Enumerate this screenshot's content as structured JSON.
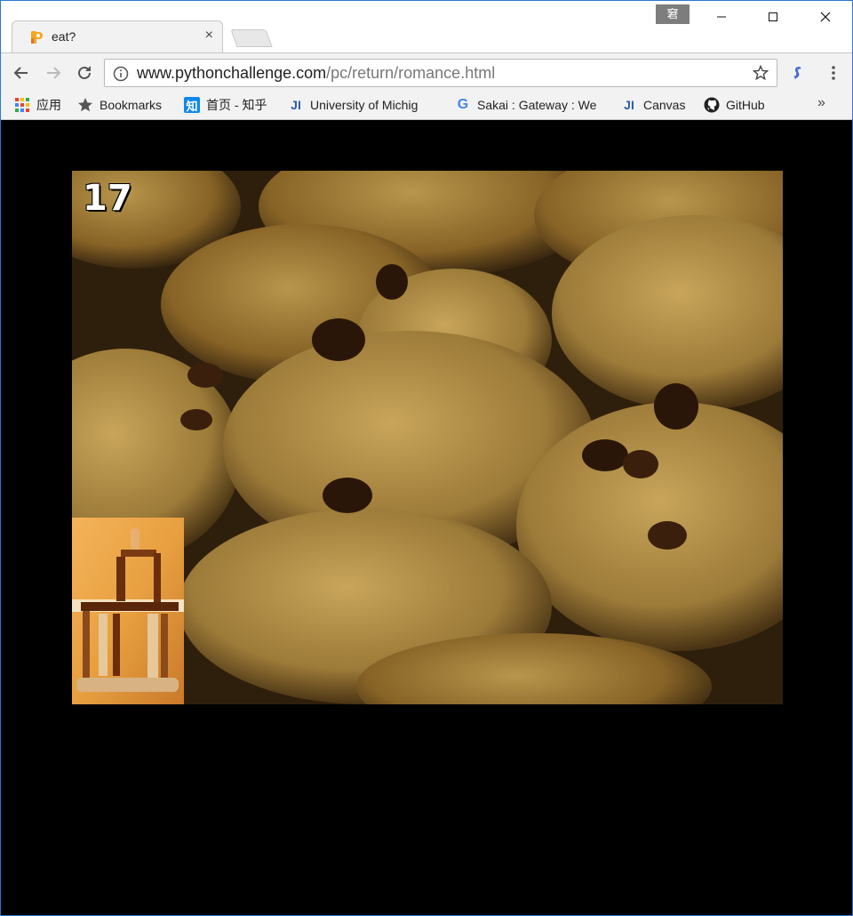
{
  "window": {
    "profile_label": "窘"
  },
  "tab": {
    "title": "eat?",
    "close_glyph": "×"
  },
  "toolbar": {
    "url_host": "www.pythonchallenge.com",
    "url_path": "/pc/return/romance.html"
  },
  "bookmarks": {
    "items": [
      {
        "label": "应用",
        "icon": "apps-grid-icon"
      },
      {
        "label": "Bookmarks",
        "icon": "star-icon"
      },
      {
        "label": "首页 - 知乎",
        "icon": "zhihu-icon",
        "icon_text": "知"
      },
      {
        "label": "University of Michig",
        "icon": "ji-icon",
        "icon_text": "JI"
      },
      {
        "label": "Sakai : Gateway : We",
        "icon": "google-icon",
        "icon_text": "G"
      },
      {
        "label": "Canvas",
        "icon": "ji-icon",
        "icon_text": "JI"
      },
      {
        "label": "GitHub",
        "icon": "github-icon"
      }
    ],
    "overflow_glyph": "»"
  },
  "content": {
    "frame_number": "17",
    "image_subject": "cookies-photo",
    "inset_subject": "wooden-machine-photo"
  },
  "colors": {
    "window_border": "#2b79d0",
    "chrome_bg": "#f2f2f2",
    "page_bg": "#000000"
  }
}
